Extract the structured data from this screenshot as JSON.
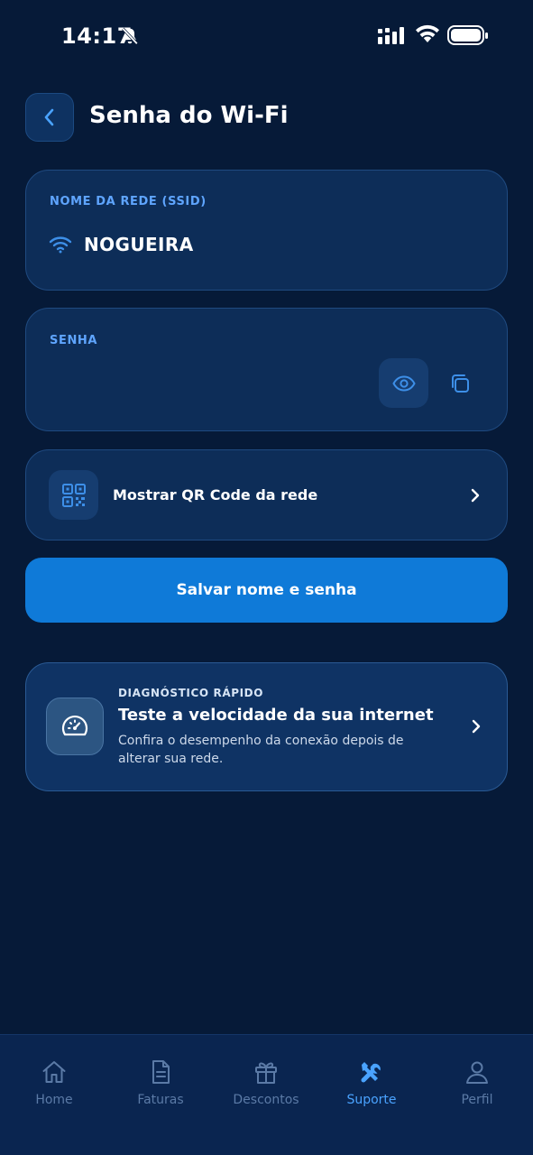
{
  "status_bar": {
    "time": "14:17",
    "icons": [
      "bell-off-icon",
      "cellular-signal-icon",
      "wifi-icon",
      "battery-icon"
    ]
  },
  "header": {
    "title": "Senha do Wi-Fi",
    "back_icon": "chevron-left-icon"
  },
  "ssid_card": {
    "label": "NOME DA REDE (SSID)",
    "value": "NOGUEIRA",
    "icon": "wifi-icon"
  },
  "password_card": {
    "label": "SENHA",
    "value": "",
    "actions": [
      "eye-icon",
      "copy-icon"
    ]
  },
  "qr_row": {
    "label": "Mostrar QR Code da rede",
    "icon": "qr-code-icon"
  },
  "save_button": {
    "label": "Salvar nome e senha"
  },
  "diagnostic_card": {
    "eyebrow": "DIAGNÓSTICO RÁPIDO",
    "title": "Teste a velocidade da sua internet",
    "description": "Confira o desempenho da conexão depois de alterar sua rede.",
    "icon": "speedometer-icon"
  },
  "bottom_nav": {
    "active": "Suporte",
    "items": [
      {
        "label": "Home",
        "icon": "home-icon"
      },
      {
        "label": "Faturas",
        "icon": "document-icon"
      },
      {
        "label": "Descontos",
        "icon": "gift-icon"
      },
      {
        "label": "Suporte",
        "icon": "tools-icon"
      },
      {
        "label": "Perfil",
        "icon": "user-icon"
      }
    ]
  },
  "colors": {
    "background": "#061a38",
    "card": "#0d2d58",
    "accent": "#0f7ad8",
    "label_blue": "#5fa5ff",
    "nav_inactive": "#5b7aa6",
    "nav_active": "#4aa3ff"
  }
}
